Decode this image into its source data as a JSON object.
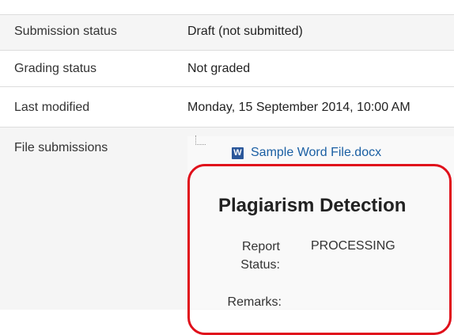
{
  "table": {
    "rows": [
      {
        "label": "Submission status",
        "value": "Draft (not submitted)"
      },
      {
        "label": "Grading status",
        "value": "Not graded"
      },
      {
        "label": "Last modified",
        "value": "Monday, 15 September 2014, 10:00 AM"
      },
      {
        "label": "File submissions"
      }
    ]
  },
  "file": {
    "icon": "word-document-icon",
    "icon_glyph": "W",
    "name": "Sample Word File.docx"
  },
  "plagiarism": {
    "title": "Plagiarism Detection",
    "report_status_label_line1": "Report",
    "report_status_label_line2": "Status:",
    "report_status_value": "PROCESSING",
    "remarks_label": "Remarks:"
  },
  "colors": {
    "highlight": "#e0101b",
    "link": "#1a5fa3",
    "shaded_row": "#f5f5f5"
  }
}
